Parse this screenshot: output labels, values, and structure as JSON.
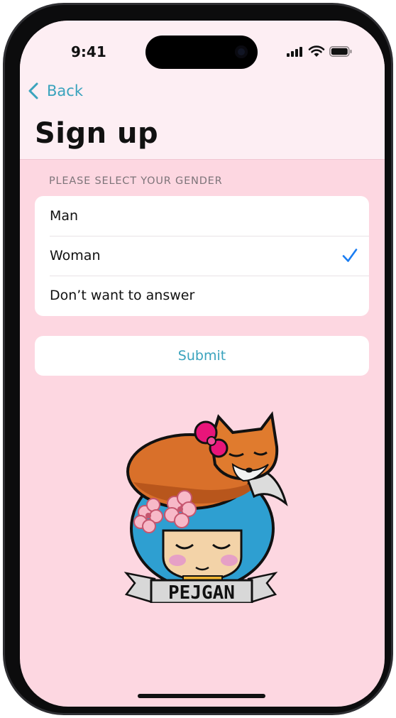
{
  "status_bar": {
    "time": "9:41"
  },
  "nav": {
    "back_label": "Back"
  },
  "page": {
    "title": "Sign up"
  },
  "gender": {
    "section_label": "PLEASE SELECT YOUR GENDER",
    "options": [
      {
        "label": "Man",
        "selected": false
      },
      {
        "label": "Woman",
        "selected": true
      },
      {
        "label": "Don’t want to answer",
        "selected": false
      }
    ]
  },
  "form": {
    "submit_label": "Submit"
  },
  "logo": {
    "text": "PEJGAN"
  },
  "colors": {
    "accent": "#3aa3bd",
    "checkmark": "#1a7df2",
    "background": "#fdd7e1",
    "header_background": "#fdeef3"
  }
}
